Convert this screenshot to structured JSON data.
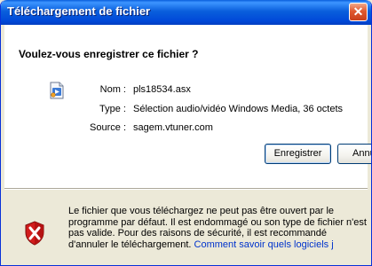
{
  "window": {
    "title": "Téléchargement de fichier",
    "close_symbol": "✕"
  },
  "dialog": {
    "question": "Voulez-vous enregistrer ce fichier ?",
    "file_icon": "windows-media-file-icon",
    "fields": [
      {
        "label": "Nom :",
        "value": "pls18534.asx"
      },
      {
        "label": "Type :",
        "value": "Sélection audio/vidéo Windows Media, 36 octets"
      },
      {
        "label": "Source :",
        "value": "sagem.vtuner.com"
      }
    ],
    "save_label": "Enregistrer",
    "cancel_label": "Annuler"
  },
  "warning": {
    "icon": "security-shield-icon",
    "text": "Le fichier que vous téléchargez ne peut pas être ouvert par le programme par défaut. Il est endommagé ou son type de fichier n'est pas valide. Pour des raisons de sécurité, il est recommandé d'annuler le téléchargement.",
    "link_text": "Comment savoir quels logiciels j"
  },
  "colors": {
    "titlebar": "#0a5fdc",
    "close_button": "#e0592f",
    "panel": "#ffffff",
    "dialog_background": "#ece9d8",
    "shield_red": "#d21c1c"
  }
}
